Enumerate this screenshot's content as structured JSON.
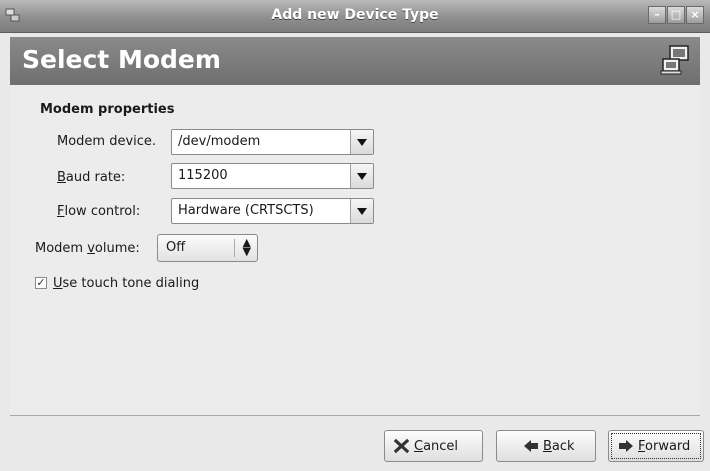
{
  "window": {
    "title": "Add new Device Type"
  },
  "banner": {
    "heading": "Select Modem"
  },
  "section": {
    "title": "Modem properties"
  },
  "fields": {
    "modem_device": {
      "label_prefix": "Modem device",
      "label_rest": ".",
      "value": "/dev/modem"
    },
    "baud_rate": {
      "label_mnemonic": "B",
      "label_rest": "aud rate:",
      "value": "115200"
    },
    "flow_control": {
      "label_mnemonic": "F",
      "label_rest": "low control:",
      "value": "Hardware (CRTSCTS)"
    },
    "modem_volume": {
      "label_before": "Modem ",
      "label_mnemonic": "v",
      "label_rest": "olume:",
      "value": "Off"
    },
    "touch_tone": {
      "label_mnemonic": "U",
      "label_rest": "se touch tone dialing",
      "checked": true,
      "check_glyph": "✓"
    }
  },
  "buttons": {
    "cancel": {
      "mnemonic": "C",
      "rest": "ancel"
    },
    "back": {
      "mnemonic": "B",
      "rest": "ack"
    },
    "forward": {
      "mnemonic": "F",
      "rest": "orward"
    }
  },
  "icons": {
    "window": "network-device-icon",
    "banner": "network-device-icon",
    "cancel": "x-icon",
    "back": "arrow-left-icon",
    "forward": "arrow-right-icon"
  }
}
